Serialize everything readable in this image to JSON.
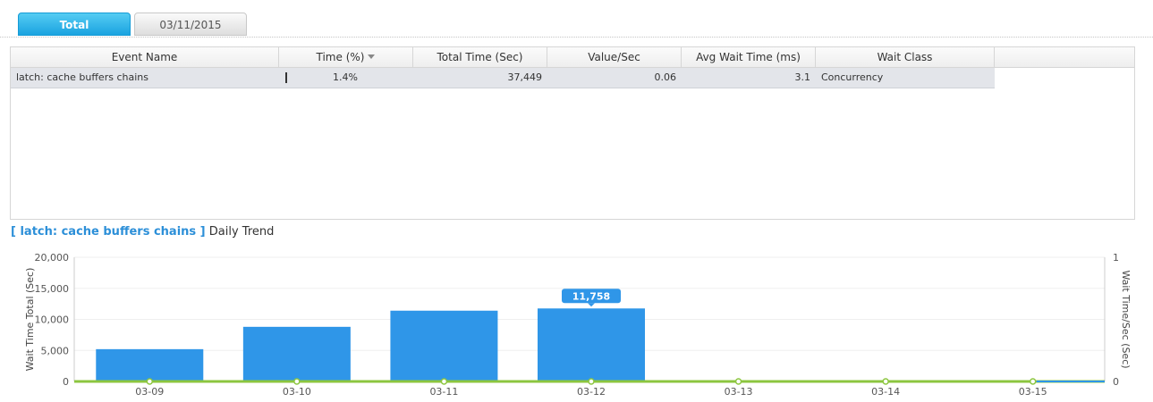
{
  "tabs": [
    {
      "label": "Total",
      "active": true
    },
    {
      "label": "03/11/2015",
      "active": false
    }
  ],
  "grid": {
    "columns": [
      "Event Name",
      "Time (%)",
      "Total Time (Sec)",
      "Value/Sec",
      "Avg Wait Time (ms)",
      "Wait Class"
    ],
    "rows": [
      {
        "event_name": "latch: cache buffers chains",
        "time_pct": "1.4%",
        "total_time": "37,449",
        "value_sec": "0.06",
        "avg_wait": "3.1",
        "wait_class": "Concurrency"
      }
    ]
  },
  "trend": {
    "event": "[ latch: cache buffers chains ]",
    "suffix": " Daily Trend"
  },
  "chart_data": {
    "type": "bar",
    "categories": [
      "03-09",
      "03-10",
      "03-11",
      "03-12",
      "03-13",
      "03-14",
      "03-15"
    ],
    "series": [
      {
        "values": [
          5200,
          8800,
          11400,
          11758,
          0,
          0,
          0
        ],
        "color": "#2f96e8",
        "axis": "left"
      },
      {
        "values": [
          0,
          0,
          0,
          0,
          0,
          0,
          0
        ],
        "color": "#8cc63f",
        "type": "line",
        "axis": "right"
      }
    ],
    "ylabel": "Wait Time Total (Sec)",
    "y2label": "Wait Time/Sec (Sec)",
    "ylim": [
      0,
      20000
    ],
    "yticks": [
      "0",
      "5,000",
      "10,000",
      "15,000",
      "20,000"
    ],
    "y2lim": [
      0,
      1
    ],
    "y2ticks": [
      "0",
      "1"
    ],
    "tooltip": {
      "category": "03-12",
      "label": "11,758"
    },
    "grid": true
  }
}
